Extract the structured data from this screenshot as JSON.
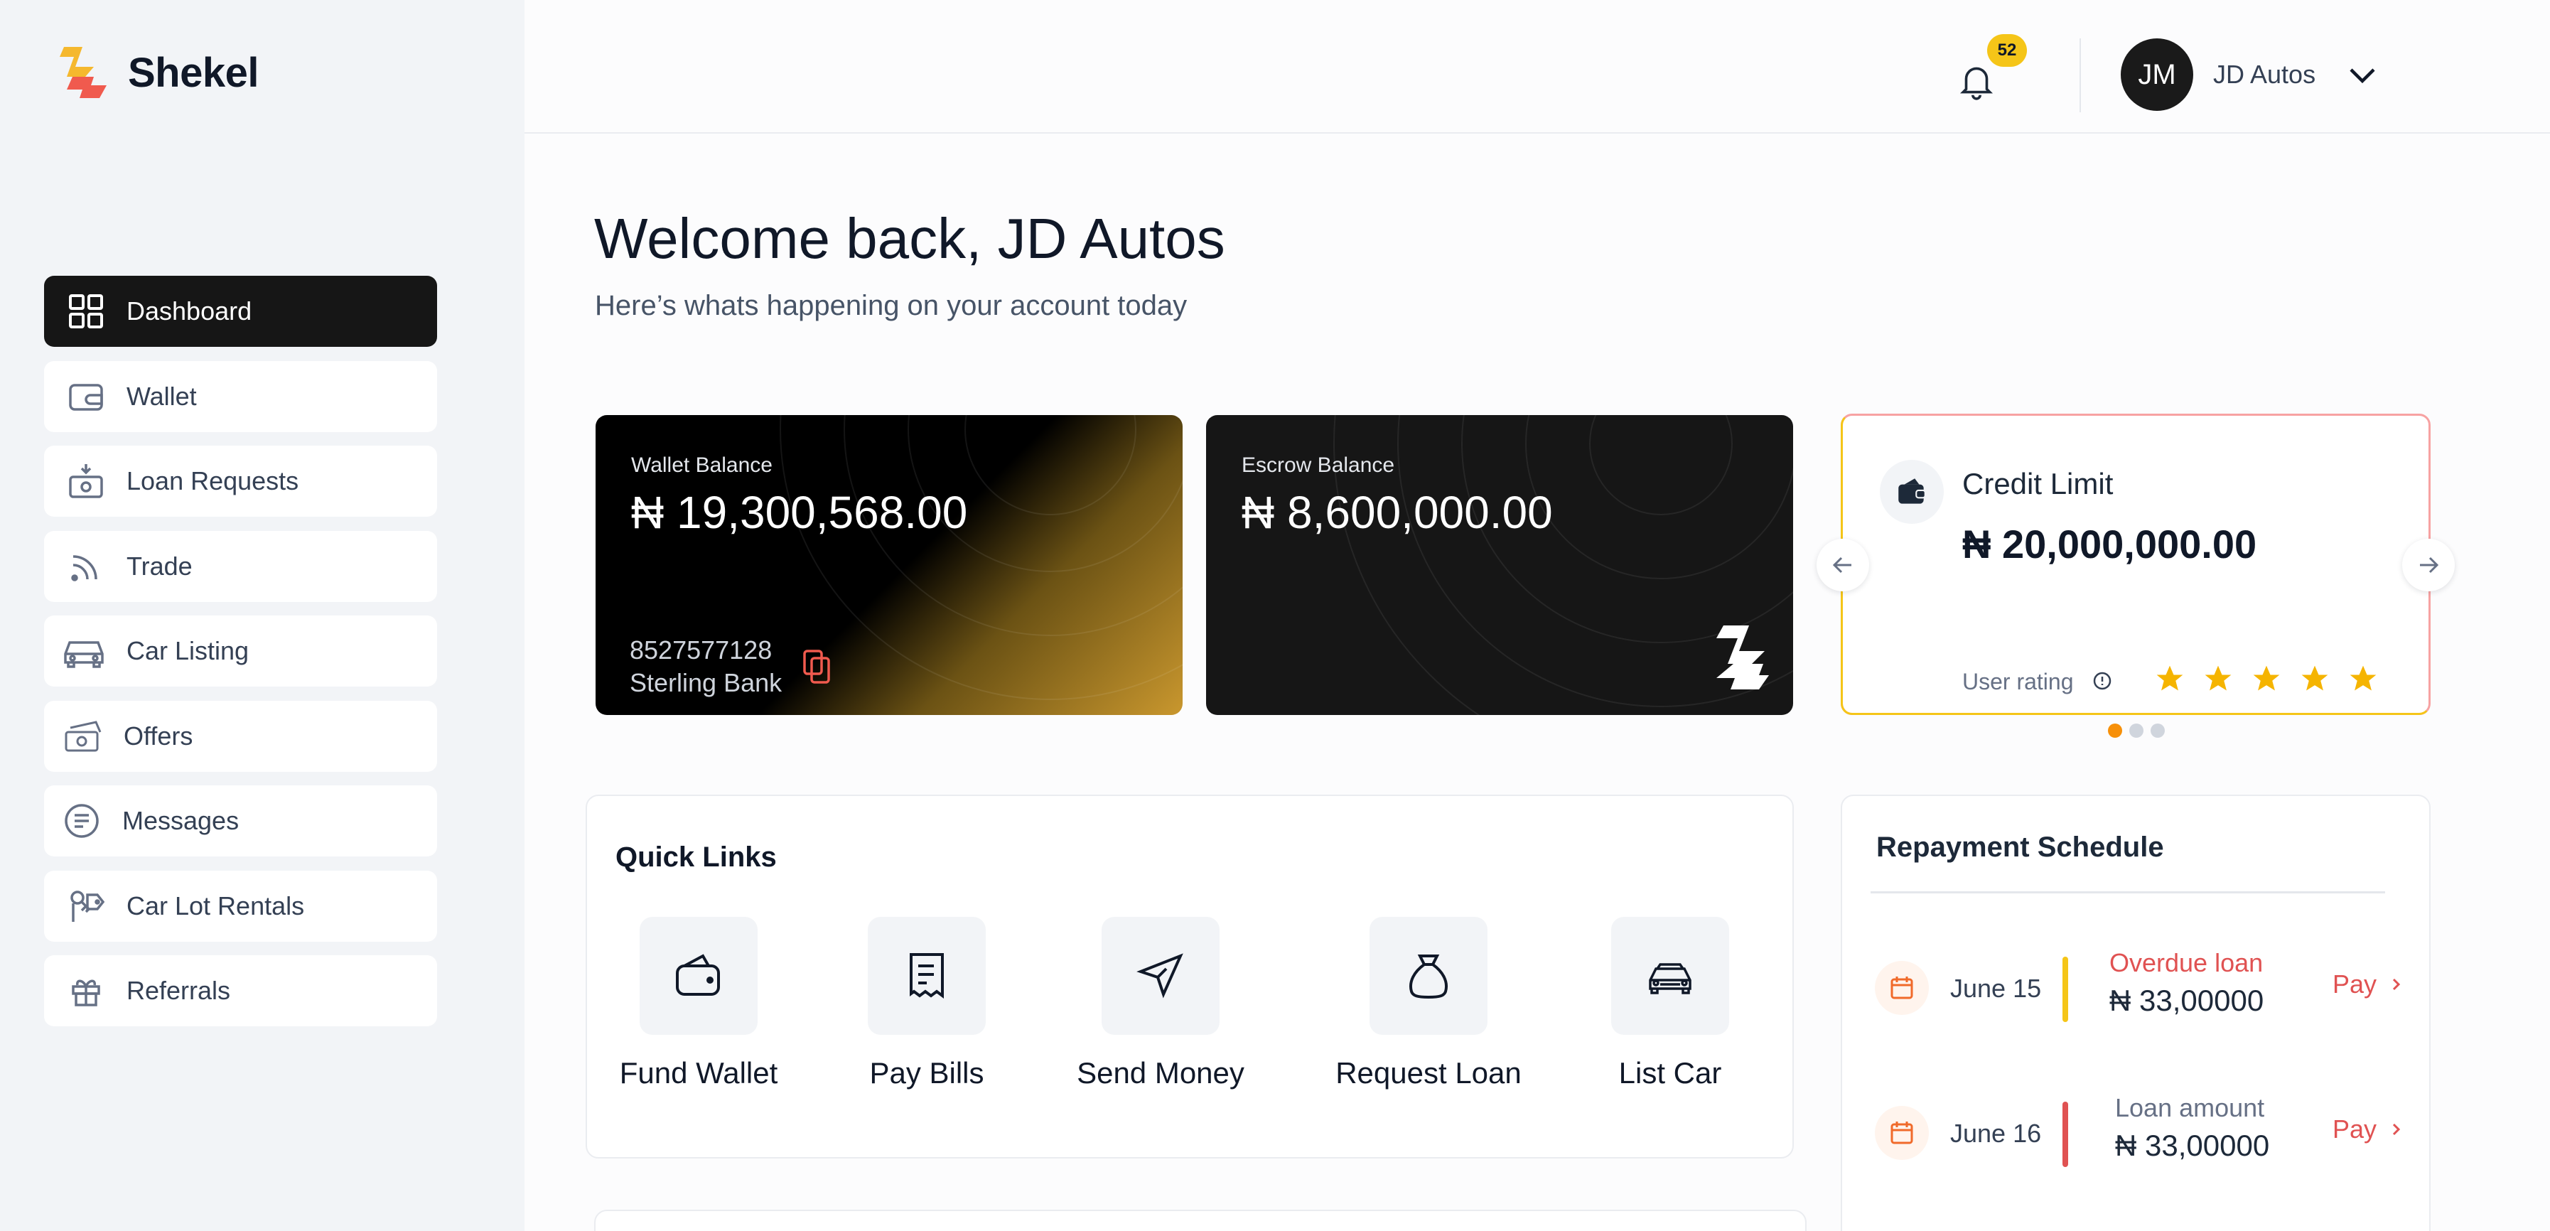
{
  "app": {
    "name": "Shekel"
  },
  "sidebar": {
    "items": [
      {
        "label": "Dashboard",
        "icon": "grid-icon",
        "active": true
      },
      {
        "label": "Wallet",
        "icon": "wallet-icon",
        "active": false
      },
      {
        "label": "Loan Requests",
        "icon": "loan-request-icon",
        "active": false
      },
      {
        "label": "Trade",
        "icon": "trade-icon",
        "active": false
      },
      {
        "label": "Car Listing",
        "icon": "car-icon",
        "active": false
      },
      {
        "label": "Offers",
        "icon": "money-icon",
        "active": false
      },
      {
        "label": "Messages",
        "icon": "message-icon",
        "active": false
      },
      {
        "label": "Car Lot Rentals",
        "icon": "keys-icon",
        "active": false
      },
      {
        "label": "Referrals",
        "icon": "gift-icon",
        "active": false
      }
    ]
  },
  "header": {
    "notification_count": "52",
    "user_initials": "JM",
    "user_name": "JD Autos"
  },
  "welcome": {
    "title": "Welcome back, JD Autos",
    "subtitle": "Here’s whats happening on your account today"
  },
  "cards": {
    "wallet": {
      "label": "Wallet Balance",
      "amount": "₦ 19,300,568.00",
      "account_number": "8527577128",
      "bank": "Sterling Bank"
    },
    "escrow": {
      "label": "Escrow Balance",
      "amount": "₦ 8,600,000.00"
    },
    "credit": {
      "title": "Credit Limit",
      "amount": "₦ 20,000,000.00",
      "rating_label": "User rating",
      "rating": 5,
      "rating_max": 5,
      "carousel_page": 1,
      "carousel_pages": 3
    }
  },
  "quick_links": {
    "title": "Quick Links",
    "items": [
      {
        "label": "Fund Wallet",
        "icon": "wallet-icon"
      },
      {
        "label": "Pay Bills",
        "icon": "receipt-icon"
      },
      {
        "label": "Send Money",
        "icon": "send-icon"
      },
      {
        "label": "Request Loan",
        "icon": "money-bag-icon"
      },
      {
        "label": "List Car",
        "icon": "car-icon"
      }
    ]
  },
  "repayment": {
    "title": "Repayment Schedule",
    "rows": [
      {
        "date": "June 15",
        "label": "Overdue loan",
        "amount": "₦ 33,00000",
        "pay_label": "Pay",
        "bar_color": "#f5c518",
        "label_color": "#e05252"
      },
      {
        "date": "June 16",
        "label": "Loan amount",
        "amount": "₦ 33,00000",
        "pay_label": "Pay",
        "bar_color": "#e05252",
        "label_color": "#667085"
      }
    ]
  },
  "colors": {
    "brand_yellow": "#f5b82e",
    "brand_red": "#f05a4e",
    "accent_pay": "#e05252",
    "star": "#f5b400"
  }
}
